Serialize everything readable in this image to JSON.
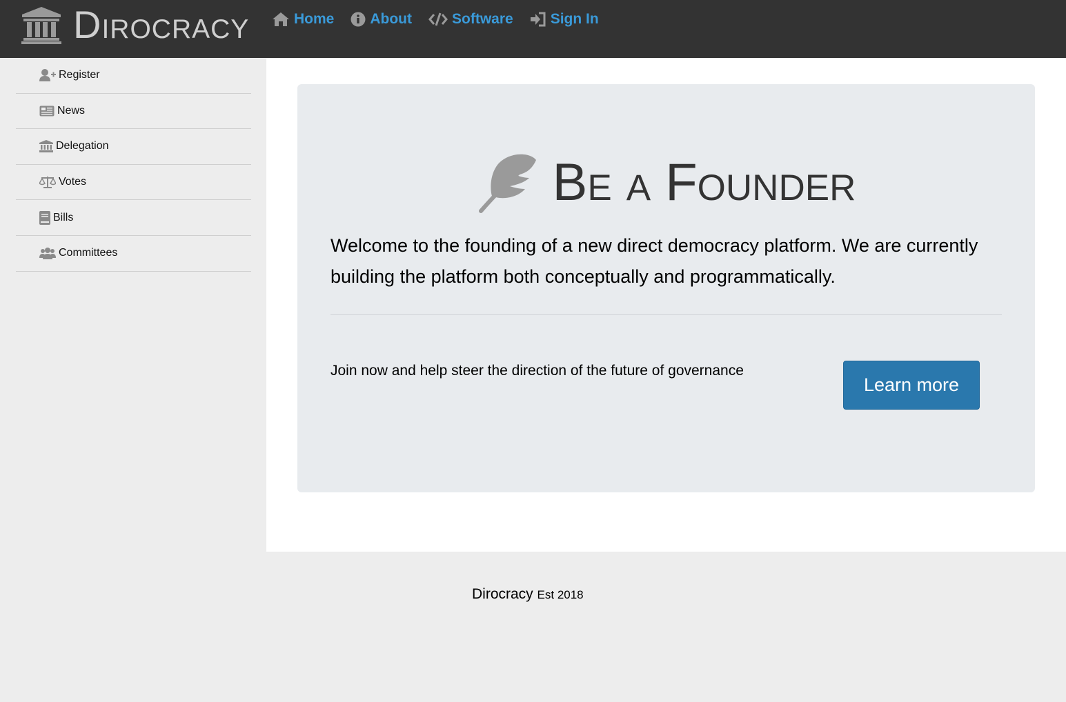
{
  "brand": {
    "name": "Dirocracy"
  },
  "nav": {
    "items": [
      {
        "label": "Home",
        "icon": "home-icon"
      },
      {
        "label": "About",
        "icon": "info-icon"
      },
      {
        "label": "Software",
        "icon": "code-icon"
      },
      {
        "label": "Sign In",
        "icon": "sign-in-icon"
      }
    ]
  },
  "sidebar": {
    "items": [
      {
        "label": "Register",
        "icon": "user-plus-icon"
      },
      {
        "label": "News",
        "icon": "newspaper-icon"
      },
      {
        "label": "Delegation",
        "icon": "institution-icon"
      },
      {
        "label": "Votes",
        "icon": "balance-scale-icon"
      },
      {
        "label": "Bills",
        "icon": "book-icon"
      },
      {
        "label": "Committees",
        "icon": "users-icon"
      }
    ]
  },
  "hero": {
    "title": "Be a Founder",
    "icon": "feather-icon",
    "lead": "Welcome to the founding of a new direct democracy platform. We are currently building the platform both conceptually and programmatically.",
    "join_text": "Join now and help steer the direction of the future of governance",
    "button_label": "Learn more"
  },
  "footer": {
    "name": "Dirocracy",
    "established": "Est 2018"
  },
  "colors": {
    "topbar": "#333333",
    "nav_link": "#3a9ad9",
    "button": "#2a78ad",
    "jumbotron": "#e8ebee"
  }
}
